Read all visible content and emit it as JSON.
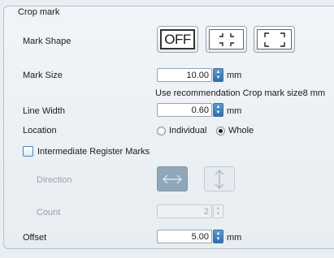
{
  "group": {
    "title": "Crop mark"
  },
  "mark_shape": {
    "label": "Mark Shape",
    "options": [
      {
        "name": "off",
        "label": "OFF",
        "selected": true
      },
      {
        "name": "corner-inner-icon",
        "label": "",
        "selected": false
      },
      {
        "name": "corner-outer-icon",
        "label": "",
        "selected": false
      }
    ]
  },
  "mark_size": {
    "label": "Mark Size",
    "value": "10.00",
    "unit": "mm",
    "hint": "Use recommendation Crop mark size8 mm"
  },
  "line_width": {
    "label": "Line Width",
    "value": "0.60",
    "unit": "mm"
  },
  "location": {
    "label": "Location",
    "options": [
      {
        "label": "Individual",
        "selected": false
      },
      {
        "label": "Whole",
        "selected": true
      }
    ]
  },
  "intermediate": {
    "label": "Intermediate Register Marks",
    "checked": false
  },
  "direction": {
    "label": "Direction",
    "options": [
      {
        "icon": "horizontal-arrows-icon",
        "selected": true
      },
      {
        "icon": "vertical-arrows-icon",
        "selected": false
      }
    ]
  },
  "count": {
    "label": "Count",
    "value": "2"
  },
  "offset": {
    "label": "Offset",
    "value": "5.00",
    "unit": "mm"
  }
}
